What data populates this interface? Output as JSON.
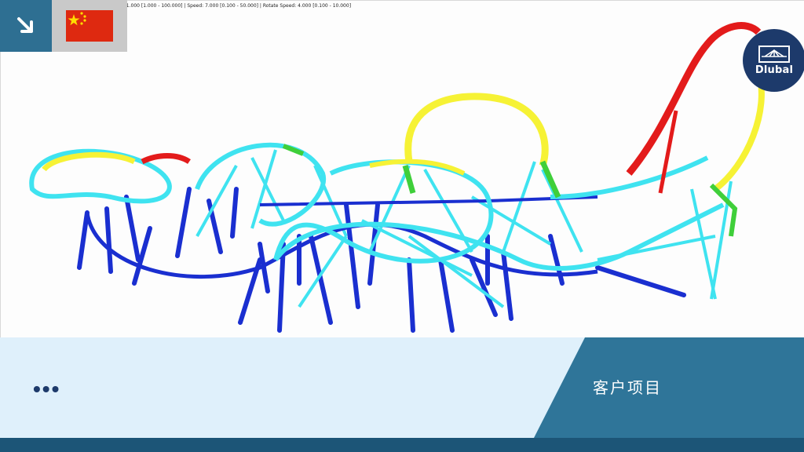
{
  "viewport": {
    "status_text": "m: 1.000 [1.000 - 100.000]  |  Speed: 7.000 [0.100 - 50.000]  |  Rotate Speed: 4.000 [0.100 - 10.000]"
  },
  "nav": {
    "arrow_icon": "arrow-down-right-icon",
    "flag_icon": "china-flag-icon"
  },
  "logo": {
    "brand": "Dlubal",
    "icon": "bridge-icon"
  },
  "footer": {
    "more_label": "•••",
    "section_label": "客户项目"
  },
  "colors": {
    "nav_blue": "#2e6f92",
    "logo_navy": "#1d3a6b",
    "panel_light": "#dff0fb",
    "panel_accent": "#2f7599",
    "strip": "#1c5577",
    "track_cyan": "#3fe3f0",
    "track_yellow": "#f6f235",
    "track_red": "#e31b1b",
    "track_green": "#3fcf3a",
    "support_blue": "#1a2fd0"
  }
}
